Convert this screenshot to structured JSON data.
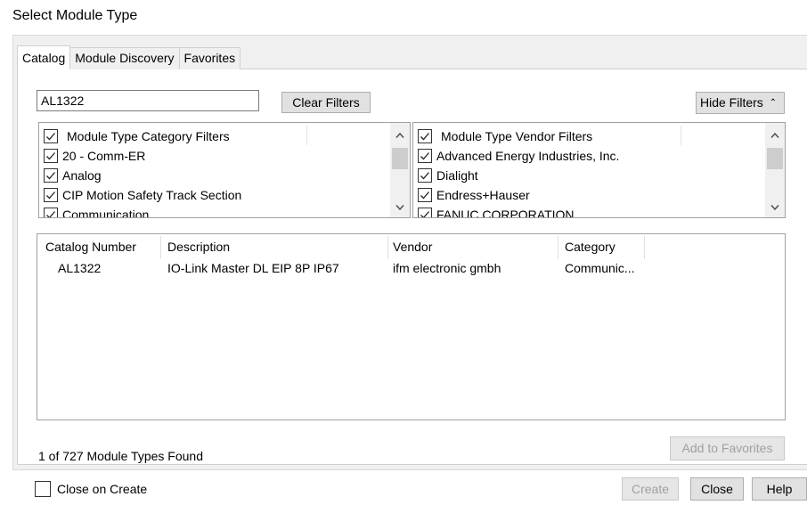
{
  "window": {
    "title": "Select Module Type"
  },
  "tabs": [
    {
      "label": "Catalog",
      "active": true
    },
    {
      "label": "Module Discovery",
      "active": false
    },
    {
      "label": "Favorites",
      "active": false
    }
  ],
  "search": {
    "value": "AL1322"
  },
  "buttons": {
    "clear_filters": "Clear Filters",
    "hide_filters": "Hide Filters",
    "add_to_favorites": "Add to Favorites",
    "create": "Create",
    "close": "Close",
    "help": "Help"
  },
  "category_filters": {
    "header": "Module Type Category Filters",
    "items": [
      "20 - Comm-ER",
      "Analog",
      "CIP Motion Safety Track Section",
      "Communication"
    ]
  },
  "vendor_filters": {
    "header": "Module Type Vendor Filters",
    "items": [
      "Advanced Energy Industries, Inc.",
      "Dialight",
      "Endress+Hauser",
      "FANUC CORPORATION"
    ]
  },
  "results": {
    "columns": [
      "Catalog Number",
      "Description",
      "Vendor",
      "Category"
    ],
    "rows": [
      [
        "AL1322",
        "IO-Link Master DL EIP 8P IP67",
        "ifm electronic gmbh",
        "Communic..."
      ]
    ]
  },
  "status": {
    "text": "1 of 727 Module Types Found"
  },
  "close_on_create": {
    "label": "Close on Create",
    "checked": false
  },
  "colors": {
    "window_bg": "#f0f0f0",
    "button_bg": "#e1e1e1",
    "disabled_text": "#a0a0a0"
  }
}
